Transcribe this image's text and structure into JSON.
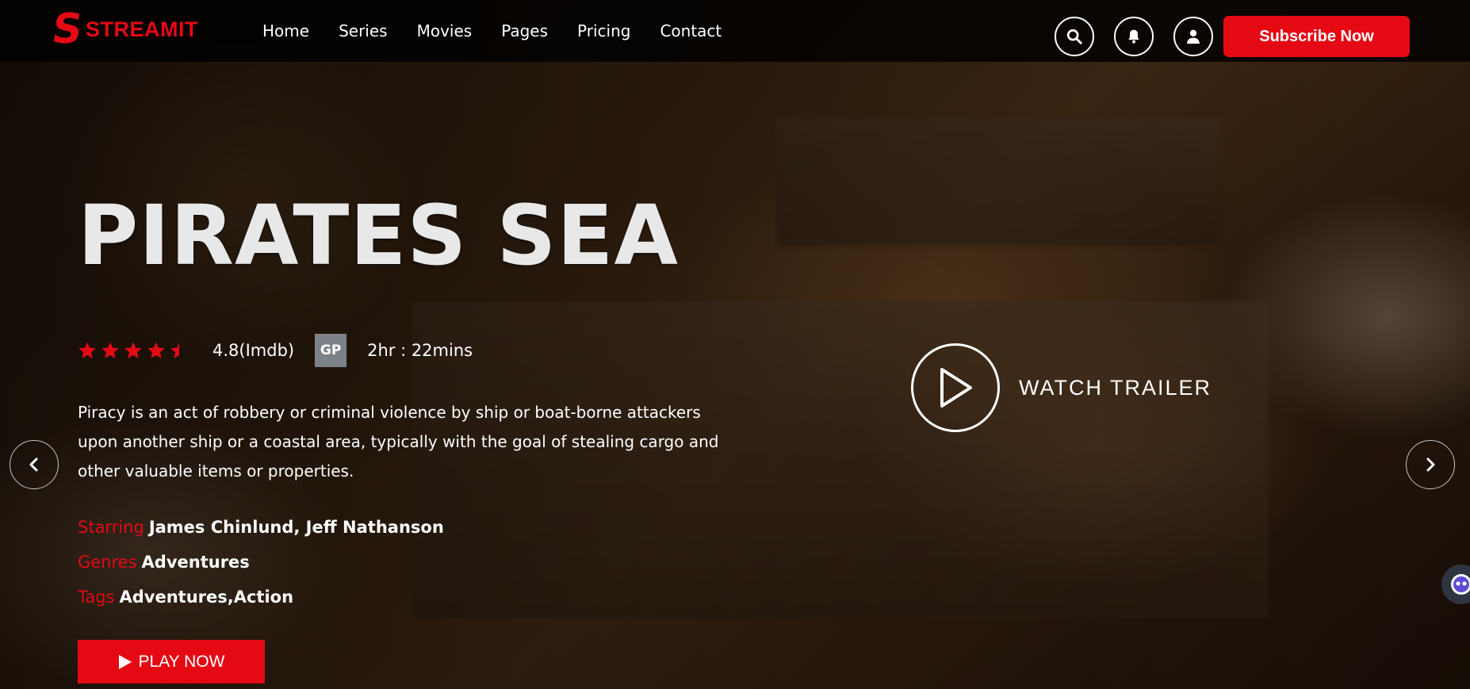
{
  "brand": {
    "logo_letter": "S",
    "name": "STREAMIT",
    "color": "#e50914"
  },
  "nav": {
    "items": [
      "Home",
      "Series",
      "Movies",
      "Pages",
      "Pricing",
      "Contact"
    ]
  },
  "header": {
    "icons": [
      "search-icon",
      "bell-icon",
      "user-icon"
    ],
    "subscribe_label": "Subscribe Now"
  },
  "hero": {
    "title": "PIRATES SEA",
    "rating_stars": 4.5,
    "rating_text": "4.8(Imdb)",
    "badge": "GP",
    "duration": "2hr : 22mins",
    "description": "Piracy is an act of robbery or criminal violence by ship or boat-borne attackers upon another ship or a coastal area, typically with the goal of stealing cargo and other valuable items or properties.",
    "starring_label": "Starring",
    "starring_value": "James Chinlund, Jeff Nathanson",
    "genres_label": "Genres",
    "genres_value": "Adventures",
    "tags_label": "Tags",
    "tags_value": "Adventures,Action",
    "play_label": "PLAY NOW",
    "trailer_label": "WATCH TRAILER"
  },
  "colors": {
    "accent": "#e50914",
    "badge_bg": "#7d8288"
  }
}
